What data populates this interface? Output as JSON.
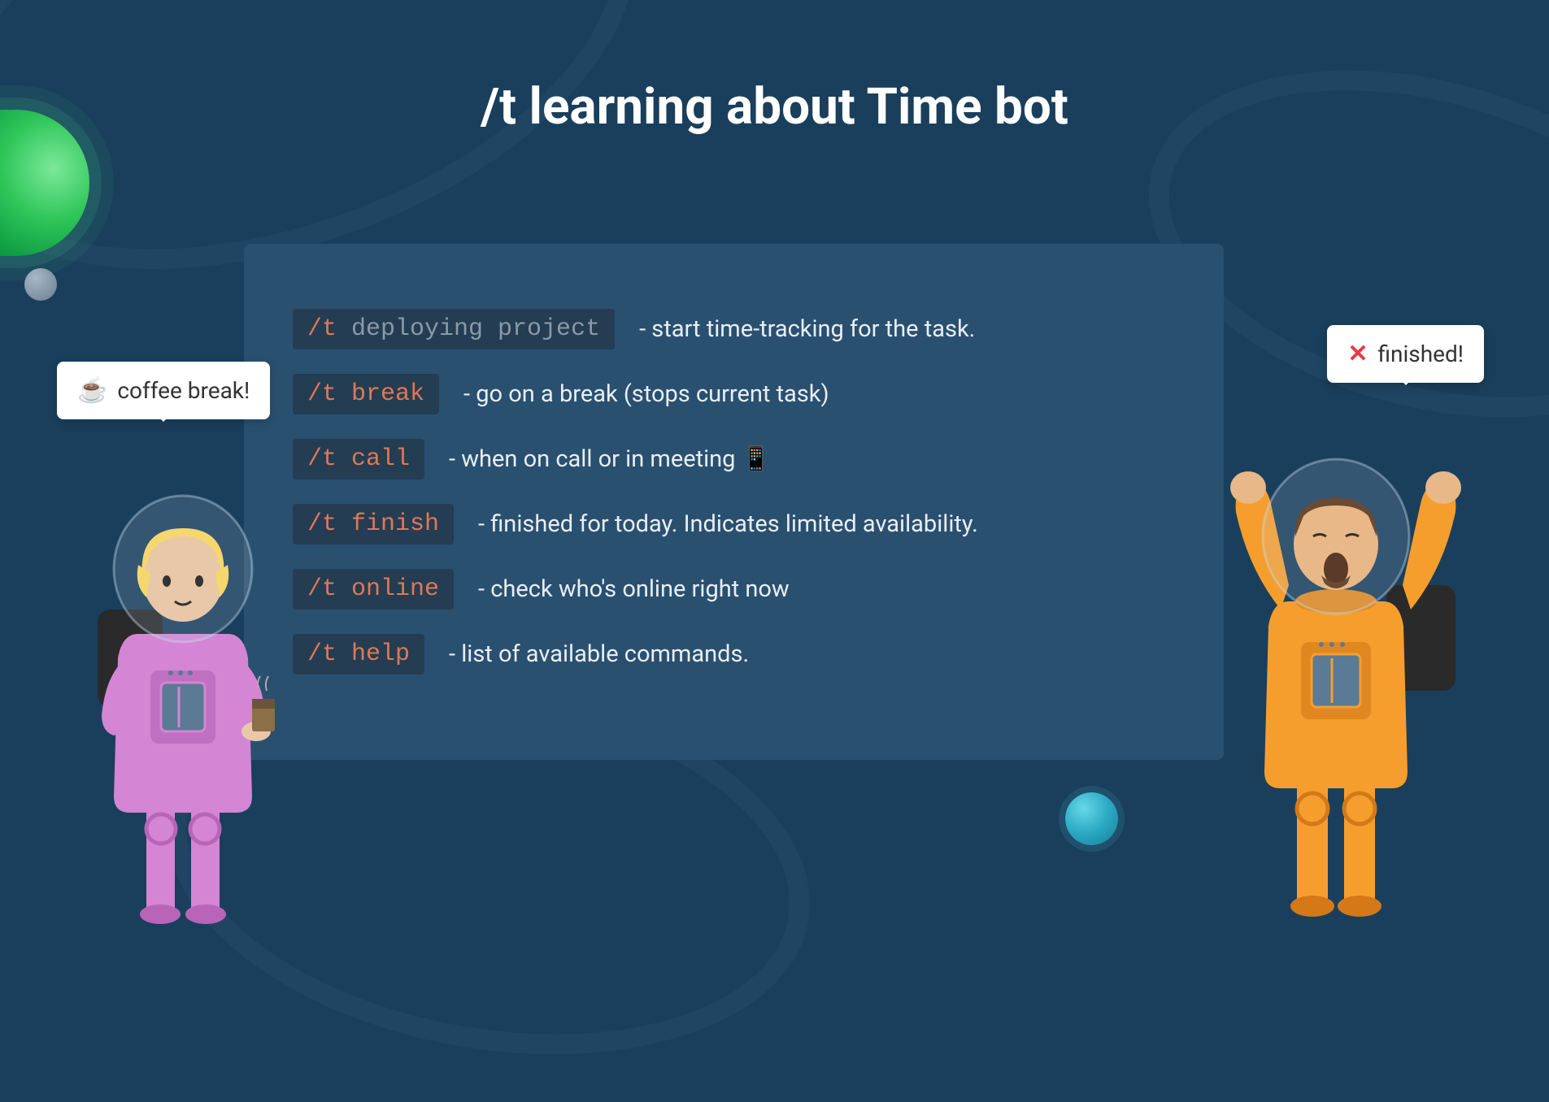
{
  "title": "/t learning about Time bot",
  "commands": [
    {
      "cmd": "/t",
      "arg": " deploying project",
      "desc": "- start time-tracking for the task."
    },
    {
      "cmd": "/t break",
      "arg": "",
      "desc": "- go on a break (stops current task)"
    },
    {
      "cmd": "/t call",
      "arg": "",
      "desc": "- when on call or in meeting 📱"
    },
    {
      "cmd": "/t finish",
      "arg": "",
      "desc": " - finished for today. Indicates limited availability."
    },
    {
      "cmd": "/t online",
      "arg": "",
      "desc": " - check who's online right now"
    },
    {
      "cmd": "/t help",
      "arg": "",
      "desc": "- list of available commands."
    }
  ],
  "bubble_left": {
    "icon": "☕",
    "text": "coffee break!"
  },
  "bubble_right": {
    "icon": "✕",
    "text": "finished!"
  }
}
